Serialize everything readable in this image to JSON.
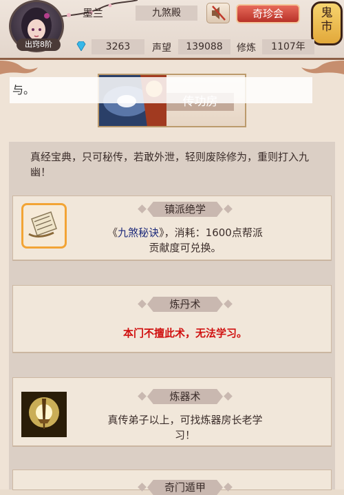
{
  "player": {
    "name": "墨兰",
    "rank_badge": "出窍8阶",
    "sect": "九煞殿"
  },
  "buttons": {
    "treasure": "奇珍会",
    "lantern": "鬼市"
  },
  "stats": {
    "gems": "3263",
    "reputation_label": "声望",
    "reputation": "139088",
    "cultivation_label": "修炼",
    "cultivation": "1107年"
  },
  "banner": {
    "label": "传功房"
  },
  "notice": "与。",
  "intro": "真经宝典，只可秘传，若敢外泄，轻则废除修为，重则打入九幽！",
  "cards": [
    {
      "title": "镇派绝学",
      "desc_prefix": "《",
      "desc_link": "九煞秘诀",
      "desc_suffix": "》，消耗：1600点帮派贡献度可兑换。",
      "icon": "scroll-book-icon"
    },
    {
      "title": "炼丹术",
      "desc": "本门不擅此术，无法学习。",
      "icon": ""
    },
    {
      "title": "炼器术",
      "desc": "真传弟子以上，可找炼器房长老学习！",
      "icon": "golden-sword-icon"
    },
    {
      "title": "奇门遁甲"
    }
  ],
  "colors": {
    "accent_red": "#d0100f",
    "button_red": "#c4402f",
    "panel_bg": "#efe3d6"
  }
}
